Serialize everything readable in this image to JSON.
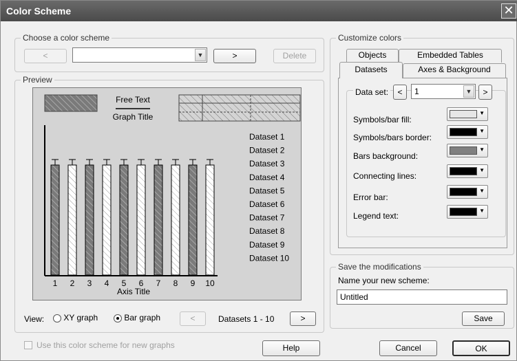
{
  "window": {
    "title": "Color Scheme",
    "close_glyph": "✕"
  },
  "scheme_group": {
    "label": "Choose a color scheme",
    "prev_label": "<",
    "selected_scheme": "",
    "next_label": ">",
    "delete_label": "Delete"
  },
  "preview": {
    "label": "Preview",
    "free_text": "Free Text",
    "graph_title": "Graph Title",
    "axis_title": "Axis Title",
    "x_ticks": [
      "1",
      "2",
      "3",
      "4",
      "5",
      "6",
      "7",
      "8",
      "9",
      "10"
    ],
    "legend": [
      "Dataset 1",
      "Dataset 2",
      "Dataset 3",
      "Dataset 4",
      "Dataset 5",
      "Dataset 6",
      "Dataset 7",
      "Dataset 8",
      "Dataset 9",
      "Dataset 10"
    ],
    "bar_fills": [
      "dark",
      "light",
      "dark",
      "light",
      "dark",
      "light",
      "dark",
      "light",
      "dark",
      "light"
    ],
    "colors": {
      "dark_bar": "#7a7a7a",
      "light_bar": "#ffffff",
      "background": "#d4d4d4"
    }
  },
  "view": {
    "label": "View:",
    "xy_option": "XY graph",
    "bar_option": "Bar graph",
    "selected": "bar",
    "prev_label": "<",
    "datasets_range": "Datasets 1 - 10",
    "next_label": ">"
  },
  "use_scheme_checkbox": {
    "label": "Use this color scheme for new graphs",
    "checked": false
  },
  "customize": {
    "label": "Customize colors",
    "tabs": [
      {
        "label": "Objects"
      },
      {
        "label": "Embedded Tables"
      },
      {
        "label": "Datasets"
      },
      {
        "label": "Axes & Background"
      }
    ],
    "active_tab": "Datasets",
    "dataset_label": "Data set:",
    "dataset_prev": "<",
    "dataset_value": "1",
    "dataset_next": ">",
    "rows": [
      {
        "label": "Symbols/bar fill:",
        "color": "#e6e6e6"
      },
      {
        "label": "Symbols/bars border:",
        "color": "#000000"
      },
      {
        "label": "Bars background:",
        "color": "#808080"
      },
      {
        "label": "Connecting lines:",
        "color": "#000000"
      },
      {
        "label": "Error bar:",
        "color": "#000000"
      },
      {
        "label": "Legend text:",
        "color": "#000000"
      }
    ]
  },
  "save_group": {
    "label": "Save the modifications",
    "name_label": "Name your new scheme:",
    "name_value": "Untitled",
    "save_button": "Save"
  },
  "footer": {
    "help": "Help",
    "cancel": "Cancel",
    "ok": "OK"
  }
}
